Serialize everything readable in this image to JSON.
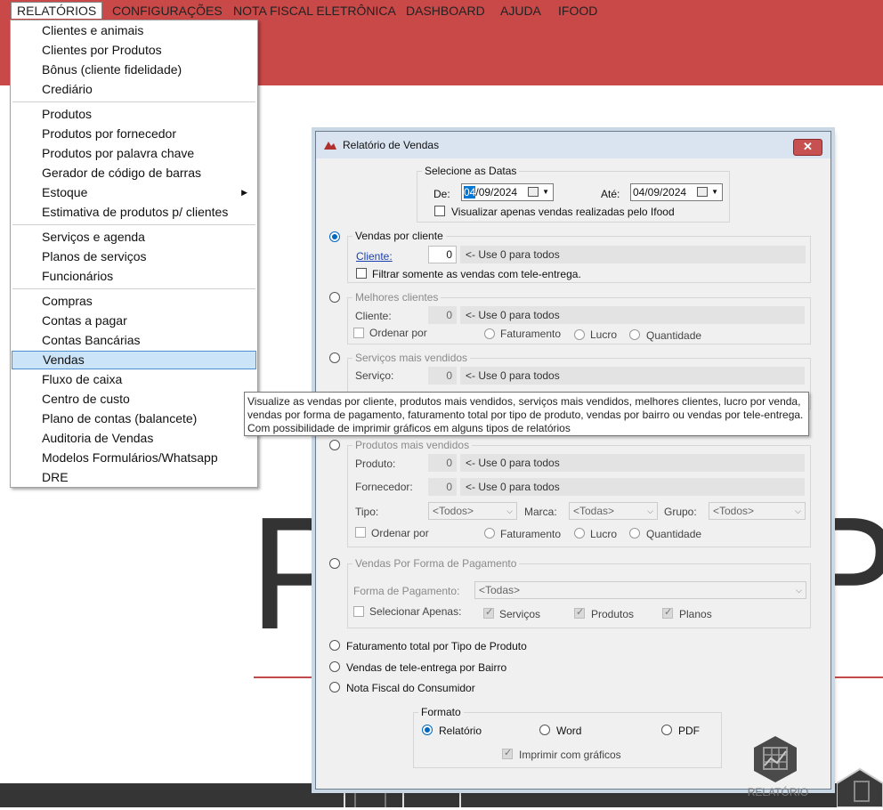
{
  "menubar": {
    "items": [
      "RELATÓRIOS",
      "CONFIGURAÇÕES",
      "NOTA FISCAL ELETRÔNICA",
      "DASHBOARD",
      "AJUDA",
      "IFOOD"
    ]
  },
  "background": {
    "big_text": "P",
    "big_text_right": "P"
  },
  "dropdown": {
    "items": [
      "Clientes e animais",
      "Clientes por Produtos",
      "Bônus (cliente fidelidade)",
      "Crediário",
      "Produtos",
      "Produtos por fornecedor",
      "Produtos por palavra chave",
      "Gerador de código de barras",
      "Estoque",
      "Estimativa de produtos p/ clientes",
      "Serviços e agenda",
      "Planos de serviços",
      "Funcionários",
      "Compras",
      "Contas a pagar",
      "Contas Bancárias",
      "Vendas",
      "Fluxo de caixa",
      "Centro de custo",
      "Plano de contas (balancete)",
      "Auditoria de Vendas",
      "Modelos Formulários/Whatsapp",
      "DRE"
    ],
    "selected": "Vendas"
  },
  "dialog": {
    "title": "Relatório de Vendas",
    "close": "✕",
    "dates": {
      "group_label": "Selecione as Datas",
      "from_label": "De:",
      "from_highlight": "04",
      "from_rest": "/09/2024",
      "to_label": "Até:",
      "to_value": "04/09/2024",
      "ifood_check": "Visualizar apenas vendas realizadas pelo Ifood"
    },
    "vendas_cliente": {
      "label": "Vendas por cliente",
      "cliente_link": "Cliente:",
      "cliente_value": "0",
      "hint": "<- Use 0 para todos",
      "tele_check": "Filtrar somente as vendas com tele-entrega."
    },
    "melhores": {
      "label": "Melhores clientes",
      "cliente_label": "Cliente:",
      "value": "0",
      "hint": "<- Use 0 para todos",
      "ordenar": "Ordenar por",
      "faturamento": "Faturamento",
      "lucro": "Lucro",
      "quantidade": "Quantidade"
    },
    "servicos": {
      "label": "Serviços mais vendidos",
      "servico_label": "Serviço:",
      "value": "0",
      "hint": "<- Use 0 para todos"
    },
    "produtos": {
      "label": "Produtos mais vendidos",
      "produto_label": "Produto:",
      "produto_value": "0",
      "hint": "<- Use 0 para todos",
      "fornecedor_label": "Fornecedor:",
      "fornecedor_value": "0",
      "tipo_label": "Tipo:",
      "tipo_value": "<Todos>",
      "marca_label": "Marca:",
      "marca_value": "<Todas>",
      "grupo_label": "Grupo:",
      "grupo_value": "<Todos>",
      "ordenar": "Ordenar por",
      "faturamento": "Faturamento",
      "lucro": "Lucro",
      "quantidade": "Quantidade"
    },
    "pagamento": {
      "label": "Vendas Por Forma de Pagamento",
      "forma_label": "Forma de Pagamento:",
      "forma_value": "<Todas>",
      "selecionar": "Selecionar Apenas:",
      "servicos": "Serviços",
      "produtos": "Produtos",
      "planos": "Planos"
    },
    "options": {
      "faturamento_tipo": "Faturamento total por Tipo de Produto",
      "tele_bairro": "Vendas de tele-entrega por Bairro",
      "nota_fiscal": "Nota Fiscal do Consumidor"
    },
    "formato": {
      "label": "Formato",
      "relatorio": "Relatório",
      "word": "Word",
      "pdf": "PDF",
      "imprimir": "Imprimir com gráficos"
    },
    "report_button": "RELATÓRIO"
  },
  "tooltip": {
    "line1": "Visualize as vendas por cliente, produtos mais vendidos, serviços mais vendidos, melhores clientes, lucro por venda,",
    "line2": "vendas por forma de pagamento, faturamento total por tipo de produto, vendas por bairro ou vendas por tele-entrega.",
    "line3": "Com possibilidade de imprimir gráficos em alguns tipos de relatórios"
  }
}
